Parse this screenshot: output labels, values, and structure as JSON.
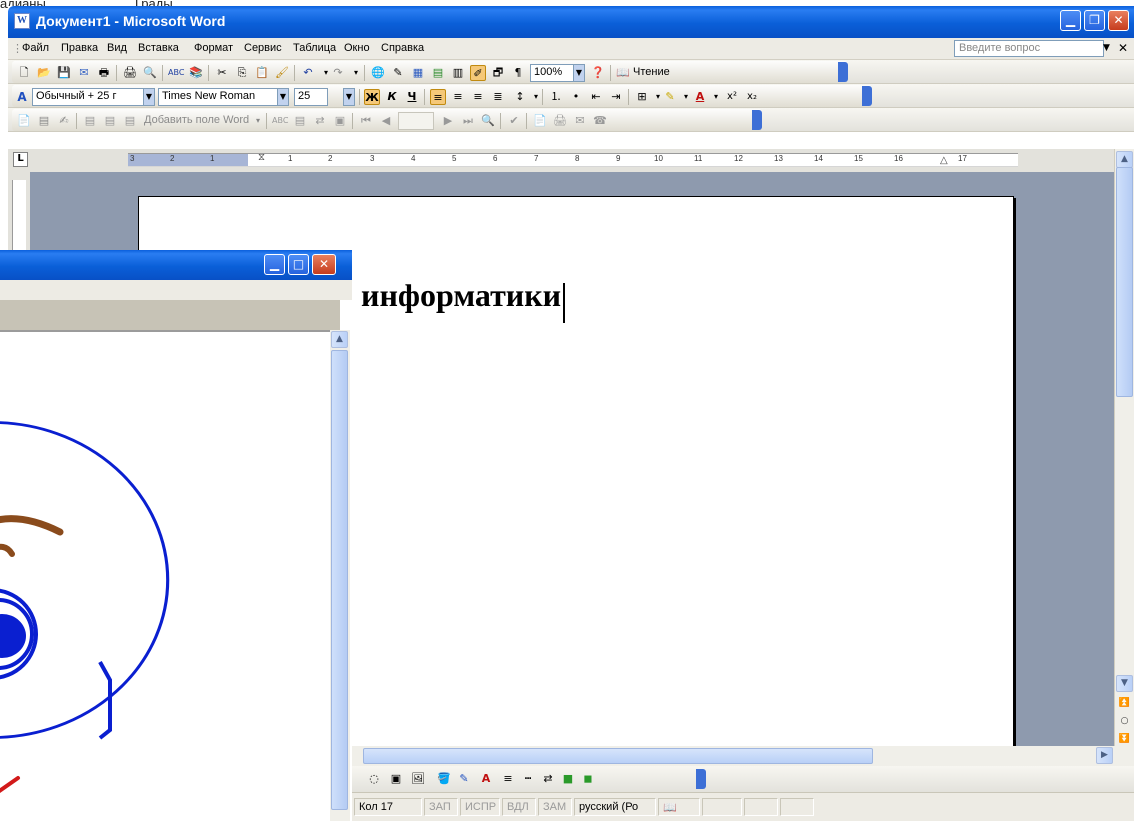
{
  "background_window": {
    "text_left": "адианы",
    "text_right": "Грады"
  },
  "word": {
    "title": "Документ1 - Microsoft Word",
    "menu": [
      "Файл",
      "Правка",
      "Вид",
      "Вставка",
      "Формат",
      "Сервис",
      "Таблица",
      "Окно",
      "Справка"
    ],
    "help_placeholder": "Введите вопрос",
    "toolbar_standard": {
      "zoom": "100%",
      "reading": "Чтение"
    },
    "toolbar_format": {
      "style": "Обычный + 25 г",
      "font": "Times New Roman",
      "size": "25",
      "bold": "Ж",
      "italic": "К",
      "underline": "Ч"
    },
    "toolbar_forms": {
      "add_field": "Добавить поле Word"
    },
    "ruler_labels": [
      "3",
      "2",
      "1",
      "1",
      "2",
      "3",
      "4",
      "5",
      "6",
      "7",
      "8",
      "9",
      "10",
      "11",
      "12",
      "13",
      "14",
      "15",
      "16",
      "17"
    ],
    "document_text": "информатики",
    "status": {
      "col": "Кол 17",
      "zap": "ЗАП",
      "ispr": "ИСПР",
      "vdl": "ВДЛ",
      "zam": "ЗАМ",
      "language": "русский (Ро"
    }
  },
  "colors": {
    "title_blue": "#0a5fd8",
    "face_blue": "#0a1fd0",
    "hair_brown": "#8a4b1c",
    "accent_red": "#d21a1a"
  }
}
